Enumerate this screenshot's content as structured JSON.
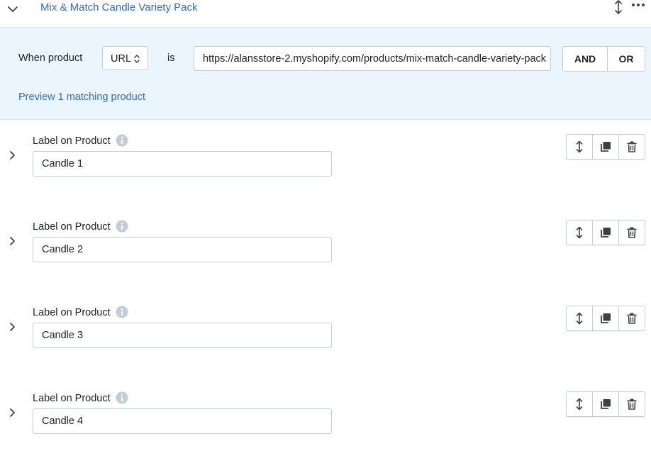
{
  "header": {
    "title": "Mix & Match Candle Variety Pack",
    "collapse_icon": "chevron-down-icon",
    "move_icon": "vertical-arrows-icon",
    "more_icon": "horizontal-dots-icon"
  },
  "condition": {
    "when_label": "When product",
    "field_select": "URL",
    "operator_label": "is",
    "url_value": "https://alansstore-2.myshopify.com/products/mix-match-candle-variety-pack",
    "and_label": "AND",
    "or_label": "OR",
    "preview_link": "Preview 1 matching product"
  },
  "rows": [
    {
      "label": "Label on Product",
      "value": "Candle 1"
    },
    {
      "label": "Label on Product",
      "value": "Candle 2"
    },
    {
      "label": "Label on Product",
      "value": "Candle 3"
    },
    {
      "label": "Label on Product",
      "value": "Candle 4"
    }
  ],
  "colors": {
    "accent": "#2c6ecb",
    "condition_bg": "#eaf5fe",
    "border": "#c4cdd5",
    "icon": "#3d4046"
  }
}
